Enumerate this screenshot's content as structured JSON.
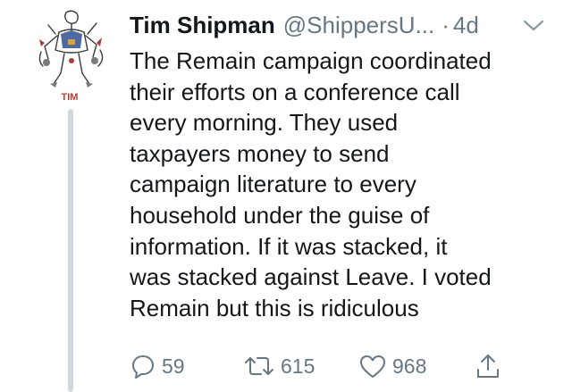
{
  "tweet": {
    "avatar_label": "TIM",
    "display_name": "Tim Shipman",
    "handle": "@ShippersU...",
    "separator": "·",
    "timestamp": "4d",
    "text_lines": [
      "The Remain campaign coordinated",
      "their efforts on a conference call",
      "every morning. They used",
      "taxpayers money to send",
      "campaign literature to every",
      "household under the guise of",
      "information. If it was stacked, it",
      "was stacked against Leave. I voted",
      "Remain but this is ridiculous"
    ],
    "actions": {
      "reply_icon": "reply-icon",
      "reply_count": "59",
      "retweet_icon": "retweet-icon",
      "retweet_count": "615",
      "like_icon": "heart-icon",
      "like_count": "968",
      "share_icon": "share-icon"
    }
  },
  "colors": {
    "text": "#14171a",
    "secondary": "#657786",
    "thread_line": "#cfd9de",
    "avatar_label": "#c0392b"
  }
}
